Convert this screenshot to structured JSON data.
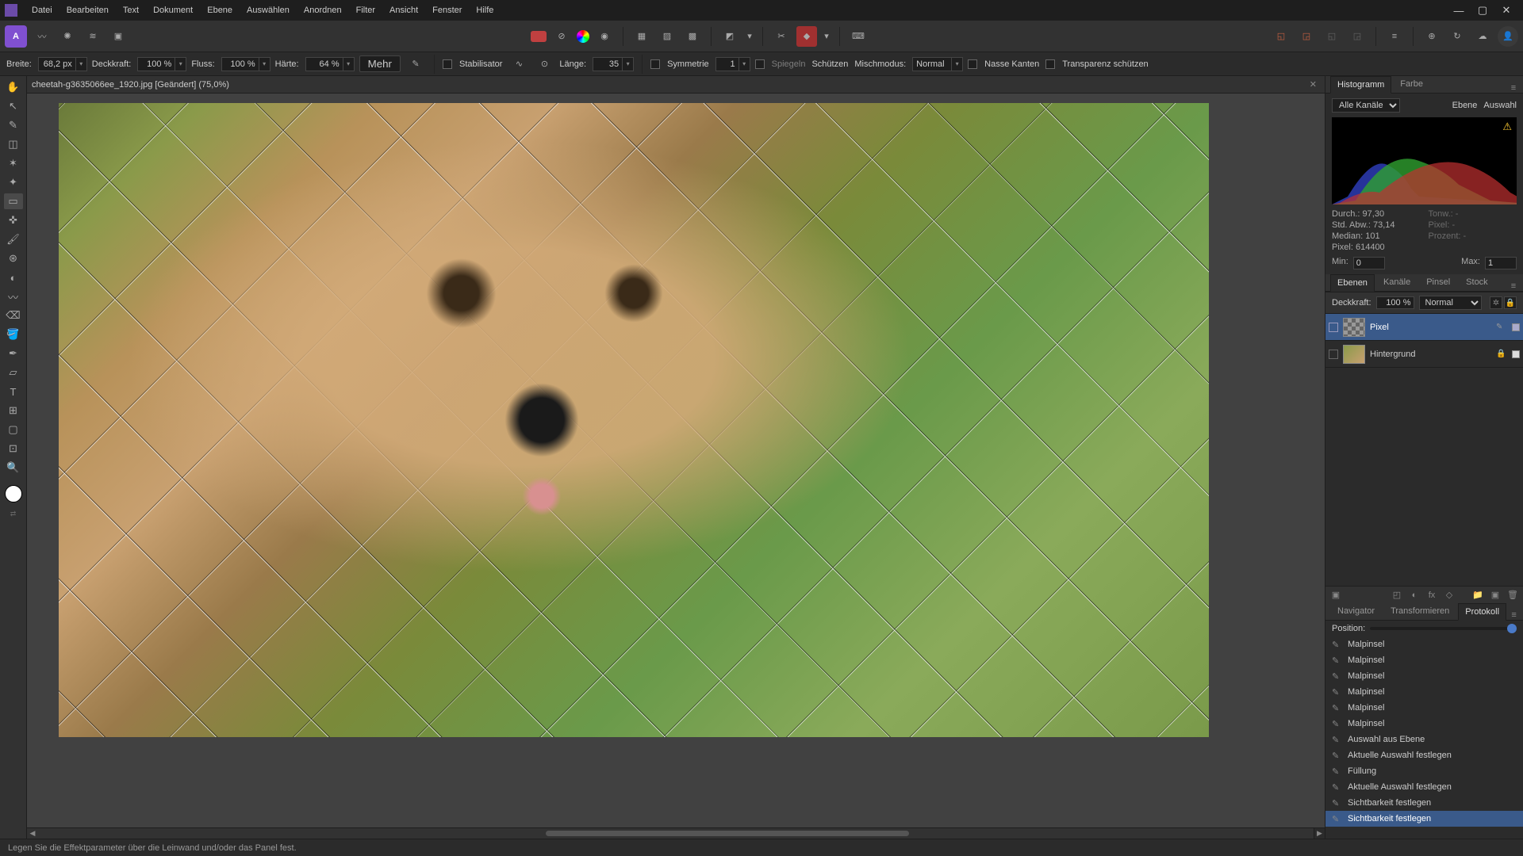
{
  "menu": {
    "items": [
      "Datei",
      "Bearbeiten",
      "Text",
      "Dokument",
      "Ebene",
      "Auswählen",
      "Anordnen",
      "Filter",
      "Ansicht",
      "Fenster",
      "Hilfe"
    ]
  },
  "win": {
    "min": "—",
    "max": "▢",
    "close": "✕"
  },
  "context": {
    "breite_lbl": "Breite:",
    "breite": "68,2 px",
    "deck_lbl": "Deckkraft:",
    "deck": "100 %",
    "fluss_lbl": "Fluss:",
    "fluss": "100 %",
    "haerte_lbl": "Härte:",
    "haerte": "64 %",
    "mehr": "Mehr",
    "stabil": "Stabilisator",
    "laenge_lbl": "Länge:",
    "laenge": "35",
    "symm_lbl": "Symmetrie",
    "symm": "1",
    "spiegeln": "Spiegeln",
    "schuetzen": "Schützen",
    "misch_lbl": "Mischmodus:",
    "misch": "Normal",
    "nasse": "Nasse Kanten",
    "transp": "Transparenz schützen"
  },
  "doc": {
    "tab": "cheetah-g3635066ee_1920.jpg [Geändert] (75,0%)"
  },
  "histogram": {
    "tab1": "Histogramm",
    "tab2": "Farbe",
    "channels": "Alle Kanäle",
    "ebene": "Ebene",
    "auswahl": "Auswahl",
    "durch_lbl": "Durch.:",
    "durch": "97,30",
    "std_lbl": "Std. Abw.:",
    "std": "73,14",
    "median_lbl": "Median:",
    "median": "101",
    "pixel_lbl": "Pixel:",
    "pixel": "614400",
    "tonw_lbl": "Tonw.:",
    "tonw": "-",
    "pixel2_lbl": "Pixel:",
    "pixel2": "-",
    "prozent_lbl": "Prozent:",
    "prozent": "-",
    "min_lbl": "Min:",
    "min": "0",
    "max_lbl": "Max:",
    "max": "1"
  },
  "layers": {
    "tabs": [
      "Ebenen",
      "Kanäle",
      "Pinsel",
      "Stock"
    ],
    "deck_lbl": "Deckkraft:",
    "deck": "100 %",
    "blend": "Normal",
    "items": [
      {
        "name": "Pixel",
        "sel": true,
        "thumb": "checker"
      },
      {
        "name": "Hintergrund",
        "sel": false,
        "thumb": "img"
      }
    ]
  },
  "history": {
    "tabs": [
      "Navigator",
      "Transformieren",
      "Protokoll"
    ],
    "pos_lbl": "Position:",
    "items": [
      "Malpinsel",
      "Malpinsel",
      "Malpinsel",
      "Malpinsel",
      "Malpinsel",
      "Malpinsel",
      "Auswahl aus Ebene",
      "Aktuelle Auswahl festlegen",
      "Füllung",
      "Aktuelle Auswahl festlegen",
      "Sichtbarkeit festlegen",
      "Sichtbarkeit festlegen"
    ],
    "selected_index": 11
  },
  "status": {
    "text": "Legen Sie die Effektparameter über die Leinwand und/oder das Panel fest."
  }
}
